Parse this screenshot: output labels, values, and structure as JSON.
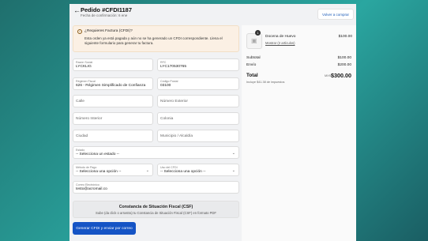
{
  "header": {
    "title": "Pedido #CFDI1187",
    "subtitle": "Fecha de confirmación: 6 ene",
    "buy_again": "Volver a comprar"
  },
  "alert": {
    "title": "¿Requieres Factura (CFDI)?",
    "body": "Esta orden ya está pagada y aún no se ha generado un CFDI correspondiente. Llena el siguiente formulario para generar tu factura."
  },
  "form": {
    "razon_social": {
      "label": "Razón Social",
      "value": "LYCKLIG"
    },
    "rfc": {
      "label": "RFC",
      "value": "LYC170530765"
    },
    "regimen": {
      "label": "Régimen Fiscal",
      "value": "626 - Régimen Simplificado de Confianza"
    },
    "cp": {
      "label": "Código Postal",
      "value": "03100"
    },
    "calle": {
      "placeholder": "Calle"
    },
    "numero_exterior": {
      "placeholder": "Número Exterior"
    },
    "numero_interior": {
      "placeholder": "Número Interior"
    },
    "colonia": {
      "placeholder": "Colonia"
    },
    "ciudad": {
      "placeholder": "Ciudad"
    },
    "municipio": {
      "placeholder": "Municipio / Alcaldía"
    },
    "estado": {
      "label": "Estado",
      "value": "-- Selecciona un estado --"
    },
    "metodo_pago": {
      "label": "Método de Pago",
      "value": "-- Selecciona una opción --"
    },
    "uso_cfdi": {
      "label": "Uso del CFDI",
      "value": "-- Selecciona una opción --"
    },
    "correo": {
      "label": "Correo Electrónico",
      "value": "testo@acromail.co"
    },
    "csf": {
      "title": "Constancia de Situación Fiscal (CSF)",
      "subtitle": "Sube (da click o arrastra) tu Constancia de Situación Fiscal (CSF) en formato PDF"
    },
    "submit": "Generar CFDI y enviar por correo"
  },
  "summary": {
    "item": {
      "qty": "1",
      "name": "Docena de Huevo",
      "price": "$100.00",
      "link": "Mostrar (2 artículos)"
    },
    "subtotal_label": "Subtotal",
    "subtotal": "$100.00",
    "envio_label": "Envío",
    "envio": "$200.00",
    "total_label": "Total",
    "currency": "MXN",
    "total": "$300.00",
    "taxes": "Incluye $41.38 de impuestos"
  }
}
